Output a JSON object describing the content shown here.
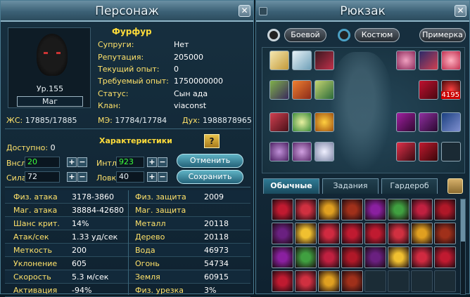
{
  "character": {
    "title": "Персонаж",
    "name": "Фурфур",
    "level": "Ур.155",
    "class": "Маг",
    "info": [
      {
        "label": "Супруги:",
        "value": "Нет"
      },
      {
        "label": "Репутация:",
        "value": "205000"
      },
      {
        "label": "Текущий опыт:",
        "value": "0"
      },
      {
        "label": "Требуемый опыт:",
        "value": "1750000000"
      },
      {
        "label": "Статус:",
        "value": "Сын ада"
      },
      {
        "label": "Клан:",
        "value": "viaconst"
      }
    ],
    "hp": {
      "label": "ЖС:",
      "value": "17885/17885"
    },
    "mp": {
      "label": "МЭ:",
      "value": "17784/17784"
    },
    "spirit": {
      "label": "Дух:",
      "value": "1988878965"
    },
    "characteristics_title": "Характеристики",
    "help_label": "?",
    "available": {
      "label": "Доступно:",
      "value": "0"
    },
    "stats": {
      "vit": {
        "label": "Внсл",
        "value": "20"
      },
      "int": {
        "label": "Интл",
        "value": "923"
      },
      "str": {
        "label": "Сила",
        "value": "72"
      },
      "dex": {
        "label": "Ловк",
        "value": "40"
      }
    },
    "plus": "+",
    "minus": "−",
    "cancel_label": "Отменить",
    "save_label": "Сохранить",
    "table": [
      {
        "l1": "Физ. атака",
        "v1": "3178-3860",
        "l2": "Физ. защита",
        "v2": "2009"
      },
      {
        "l1": "Маг. атака",
        "v1": "38884-42680",
        "l2": "Маг. защита",
        "v2": ""
      },
      {
        "l1": "Шанс крит.",
        "v1": "14%",
        "l2": "Металл",
        "v2": "20118"
      },
      {
        "l1": "Атак/сек",
        "v1": "1.33 уд/сек",
        "l2": "Дерево",
        "v2": "20118"
      },
      {
        "l1": "Меткость",
        "v1": "200",
        "l2": "Вода",
        "v2": "46973"
      },
      {
        "l1": "Уклонение",
        "v1": "605",
        "l2": "Огонь",
        "v2": "54734"
      },
      {
        "l1": "Скорость",
        "v1": "5.3 м/сек",
        "l2": "Земля",
        "v2": "60915"
      },
      {
        "l1": "Активация",
        "v1": "-94%",
        "l2": "Физ. урезка",
        "v2": "3%"
      }
    ]
  },
  "bag": {
    "title": "Рюкзак",
    "mode_battle": "Боевой",
    "mode_costume": "Костюм",
    "try_on": "Примерка",
    "item_count_badge": "4195",
    "tabs": [
      "Обычные",
      "Задания",
      "Гардероб"
    ],
    "active_tab": "Обычные"
  },
  "colors": {
    "gold": "#ffe26a",
    "name": "#ffdc3a",
    "green_value": "#3cff3c"
  }
}
